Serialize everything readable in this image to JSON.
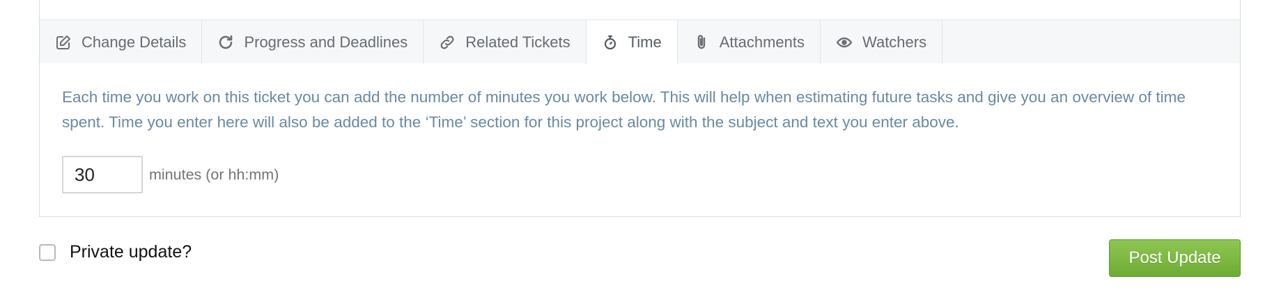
{
  "tabs": [
    {
      "label": "Change Details",
      "icon": "edit-icon"
    },
    {
      "label": "Progress and Deadlines",
      "icon": "refresh-icon"
    },
    {
      "label": "Related Tickets",
      "icon": "link-icon"
    },
    {
      "label": "Time",
      "icon": "stopwatch-icon",
      "active": true
    },
    {
      "label": "Attachments",
      "icon": "paperclip-icon"
    },
    {
      "label": "Watchers",
      "icon": "eye-icon"
    }
  ],
  "time_panel": {
    "info_text": "Each time you work on this ticket you can add the number of minutes you work below. This will help when estimating future tasks and give you an overview of time spent. Time you enter here will also be added to the ‘Time’ section for this project along with the subject and text you enter above.",
    "minutes_value": "30",
    "unit_label": "minutes (or hh:mm)"
  },
  "footer": {
    "private_label": "Private update?",
    "private_checked": false,
    "post_button": "Post Update"
  },
  "colors": {
    "info_text": "#6889a3",
    "button_green": "#7ab843"
  }
}
